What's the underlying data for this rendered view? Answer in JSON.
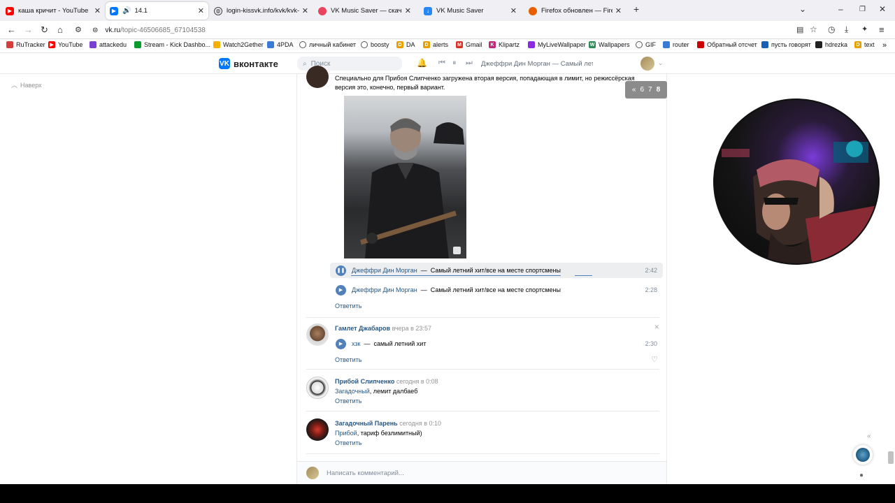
{
  "browser": {
    "tabs": [
      {
        "title": "каша кричит - YouTube",
        "favicon_color": "#ff0000"
      },
      {
        "title": "14.1",
        "favicon_color": "#0077ff",
        "active": true
      },
      {
        "title": "login-kissvk.info/kvk/kvk-auth-r",
        "favicon_color": "#444444"
      },
      {
        "title": "VK Music Saver — скачать музы",
        "favicon_color": "#e8445e"
      },
      {
        "title": "VK Music Saver",
        "favicon_color": "#2787f5"
      },
      {
        "title": "Firefox обновлен — Firefox.con",
        "favicon_color": "#e66000"
      }
    ],
    "new_tab": "+",
    "url_host": "vk.ru",
    "url_path": "/topic-46506685_67104538",
    "bookmarks": [
      {
        "label": "RuTracker",
        "color": "#d43f3a"
      },
      {
        "label": "YouTube",
        "color": "#ff0000"
      },
      {
        "label": "attackedu",
        "color": "#7b3fd4"
      },
      {
        "label": "Stream - Kick Dashbo...",
        "color": "#53fc18"
      },
      {
        "label": "Watch2Gether",
        "color": "#f5b100"
      },
      {
        "label": "4PDA",
        "color": "#3a7bd5"
      },
      {
        "label": "личный кабинет",
        "color": "#555555"
      },
      {
        "label": "boosty",
        "color": "#555555"
      },
      {
        "label": "DA",
        "color": "#e6a000"
      },
      {
        "label": "alerts",
        "color": "#e6a000"
      },
      {
        "label": "Gmail",
        "color": "#d93025"
      },
      {
        "label": "Klipartz",
        "color": "#c4257a"
      },
      {
        "label": "MyLiveWallpaper",
        "color": "#8a2be2"
      },
      {
        "label": "Wallpapers",
        "color": "#2e8b57"
      },
      {
        "label": "GIF",
        "color": "#555555"
      },
      {
        "label": "router",
        "color": "#3a7bd5"
      },
      {
        "label": "Обратный отсчет",
        "color": "#cc0000"
      },
      {
        "label": "пусть говорят",
        "color": "#1a5fb4"
      },
      {
        "label": "hdrezka",
        "color": "#222222"
      },
      {
        "label": "text",
        "color": "#e6a000"
      }
    ]
  },
  "vk": {
    "logo_text": "вконтакте",
    "search_placeholder": "Поиск",
    "now_playing": "Джеффри Дин Морган — Самый лет...",
    "scroll_top": "Наверх",
    "pager": {
      "prev": "«",
      "pages": [
        "6",
        "7",
        "8"
      ]
    }
  },
  "posts": [
    {
      "text": "Специально для Прибоя Слипченко загружена вторая версия, попадающая в лимит, но режиссёрская версия это, конечно, первый вариант.",
      "tracks": [
        {
          "artist": "Джеффри Дин Морган",
          "title": "Самый летний хит/все на месте спортсмены",
          "duration": "2:42",
          "playing": true
        },
        {
          "artist": "Джеффри Дин Морган",
          "title": "Самый летний хит/все на месте спортсмены",
          "duration": "2:28"
        }
      ],
      "reply": "Ответить"
    },
    {
      "author": "Гамлет Джабаров",
      "date": "вчера в 23:57",
      "tracks": [
        {
          "artist": "хзк",
          "title": "самый летний хит",
          "duration": "2:30"
        }
      ],
      "reply": "Ответить"
    },
    {
      "author": "Прибой Слипченко",
      "date": "сегодня в 0:08",
      "mention": "Загадочный",
      "text": ", лемит далбаеб",
      "reply": "Ответить"
    },
    {
      "author": "Загадочный Парень",
      "date": "сегодня в 0:10",
      "mention": "Прибой",
      "text": ", тариф безлимитный)",
      "reply": "Ответить"
    }
  ],
  "composer_placeholder": "Написать комментарий..."
}
